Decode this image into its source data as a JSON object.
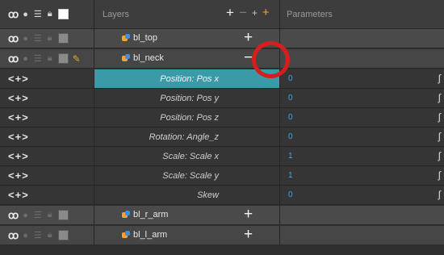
{
  "header": {
    "layers_title": "Layers",
    "parameters_title": "Parameters",
    "add_icon": "+",
    "remove_icon": "−",
    "add_peg_icon": "+",
    "add_layer_icon": "+"
  },
  "layers": [
    {
      "name": "bl_top",
      "button": "+"
    },
    {
      "name": "bl_neck",
      "button": "−"
    }
  ],
  "expand_label": "<+>",
  "parameters": [
    {
      "name": "Position: Pos x",
      "value": "0"
    },
    {
      "name": "Position: Pos y",
      "value": "0"
    },
    {
      "name": "Position: Pos z",
      "value": "0"
    },
    {
      "name": "Rotation: Angle_z",
      "value": "0"
    },
    {
      "name": "Scale: Scale x",
      "value": "1"
    },
    {
      "name": "Scale: Scale y",
      "value": "1"
    },
    {
      "name": "Skew",
      "value": "0"
    }
  ],
  "layers_bottom": [
    {
      "name": "bl_r_arm",
      "button": "+"
    },
    {
      "name": "bl_l_arm",
      "button": "+"
    }
  ],
  "colors": {
    "selected_row": "#3b9aa8",
    "value_blue": "#3fa7e6",
    "highlight_circle": "#d61e1e"
  }
}
